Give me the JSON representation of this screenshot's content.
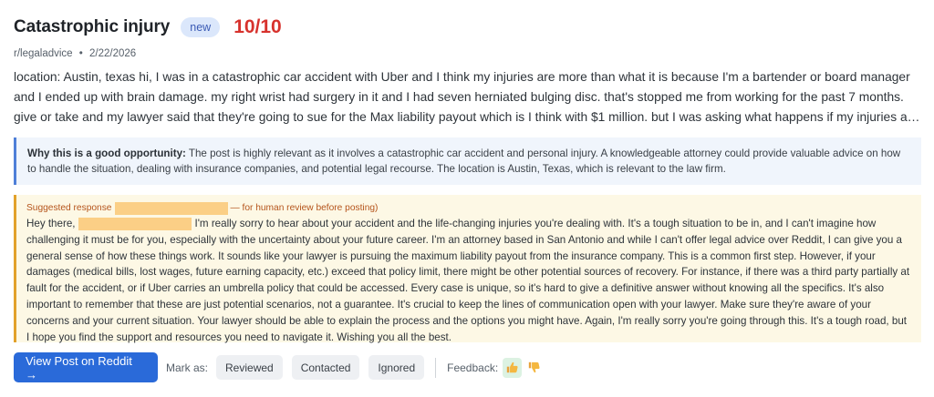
{
  "post": {
    "title": "Catastrophic injury",
    "badge": "new",
    "score": "10/10",
    "subreddit": "r/legaladvice",
    "separator": "•",
    "date": "2/22/2026",
    "body": "location: Austin, texas hi, I was in a catastrophic car accident with Uber and I think my injuries are more than what it is because I'm a bartender or board manager and I ended up with brain damage. my right wrist had surgery in it and I had seven herniated bulging disc. that's stopped me from working for the past 7 months. give or take and my lawyer said that they're going to sue for the Max liability payout which is I think with $1 million. but I was asking what happens if my injuries are more than that? li..."
  },
  "why": {
    "label": "Why this is a good opportunity:",
    "text": "The post is highly relevant as it involves a catastrophic car accident and personal injury. A knowledgeable attorney could provide valuable advice on how to handle the situation, dealing with insurance companies, and potential legal recourse. The location is Austin, Texas, which is relevant to the law firm."
  },
  "suggestion": {
    "label": "Suggested response",
    "review_note": "— for human review before posting)",
    "greeting": "Hey there,",
    "text": "I'm really sorry to hear about your accident and the life-changing injuries you're dealing with. It's a tough situation to be in, and I can't imagine how challenging it must be for you, especially with the uncertainty about your future career. I'm an attorney based in San Antonio and while I can't offer legal advice over Reddit, I can give you a general sense of how these things work. It sounds like your lawyer is pursuing the maximum liability payout from the insurance company. This is a common first step. However, if your damages (medical bills, lost wages, future earning capacity, etc.) exceed that policy limit, there might be other potential sources of recovery. For instance, if there was a third party partially at fault for the accident, or if Uber carries an umbrella policy that could be accessed. Every case is unique, so it's hard to give a definitive answer without knowing all the specifics. It's also important to remember that these are just potential scenarios, not a guarantee. It's crucial to keep the lines of communication open with your lawyer. Make sure they're aware of your concerns and your current situation. Your lawyer should be able to explain the process and the options you might have. Again, I'm really sorry you're going through this. It's a tough road, but I hope you find the support and resources you need to navigate it. Wishing you all the best."
  },
  "actions": {
    "view_label": "View Post on Reddit →",
    "mark_as": "Mark as:",
    "reviewed": "Reviewed",
    "contacted": "Contacted",
    "ignored": "Ignored",
    "feedback": "Feedback:",
    "thumbs_up_icon": "thumbs-up-icon",
    "thumbs_down_icon": "thumbs-down-icon"
  },
  "colors": {
    "score": "#d7322d",
    "primary": "#2a6ad9",
    "why_border": "#4f7fd8",
    "suggest_border": "#e2a12a",
    "suggest_label": "#b5541b",
    "redaction": "#fbcf86"
  }
}
